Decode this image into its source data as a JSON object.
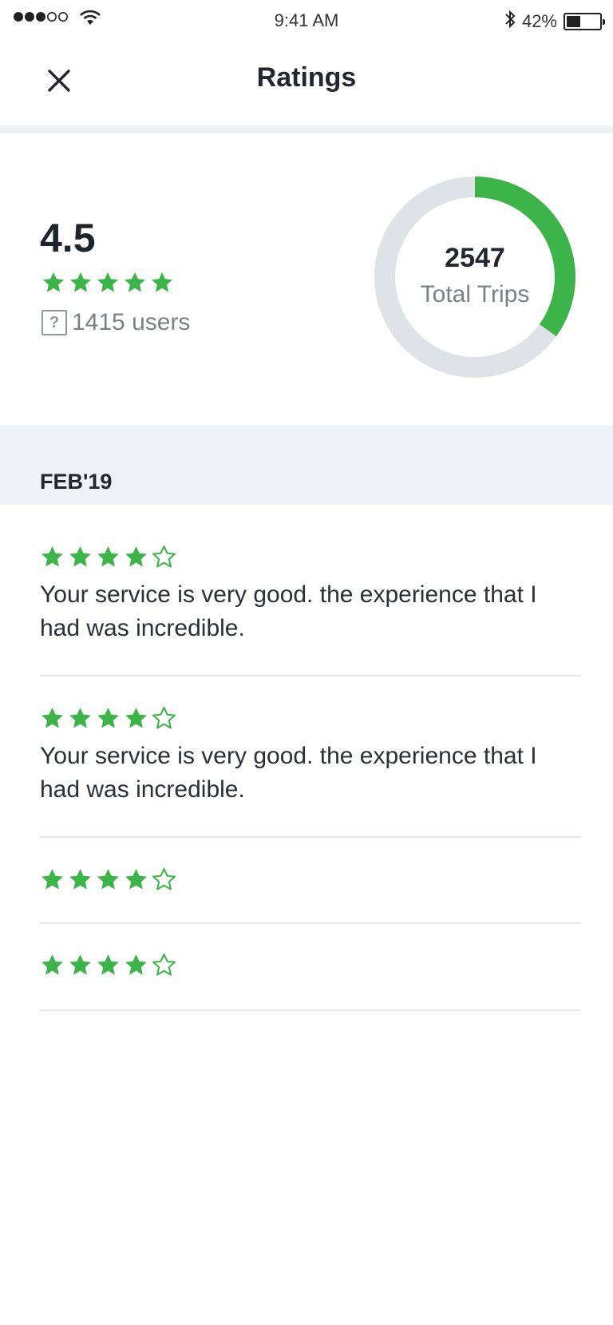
{
  "status_bar": {
    "time": "9:41 AM",
    "battery": "42%",
    "battery_level": 0.42,
    "signal_icon": "signal-dots-icon",
    "wifi_icon": "wifi-icon",
    "bluetooth_icon": "bluetooth-icon"
  },
  "header": {
    "title": "Ratings",
    "close_icon": "close-icon"
  },
  "summary": {
    "average_rating": "4.5",
    "star_count": 5,
    "users_text": "1415 users",
    "help_icon_glyph": "?",
    "total_trips": "2547",
    "total_trips_label": "Total Trips",
    "donut_fraction": 0.35
  },
  "section": {
    "title": "FEB'19"
  },
  "reviews": [
    {
      "rating": 4,
      "max": 5,
      "text": "Your service is very good. the experience that I had was incredible."
    },
    {
      "rating": 4,
      "max": 5,
      "text": "Your service is very good. the experience that I had was incredible."
    },
    {
      "rating": 4,
      "max": 5,
      "text": ""
    },
    {
      "rating": 4,
      "max": 5,
      "text": ""
    }
  ],
  "colors": {
    "accent_green": "#3cb449",
    "donut_track": "#dfe2e6",
    "section_bg": "#eef2f6"
  }
}
